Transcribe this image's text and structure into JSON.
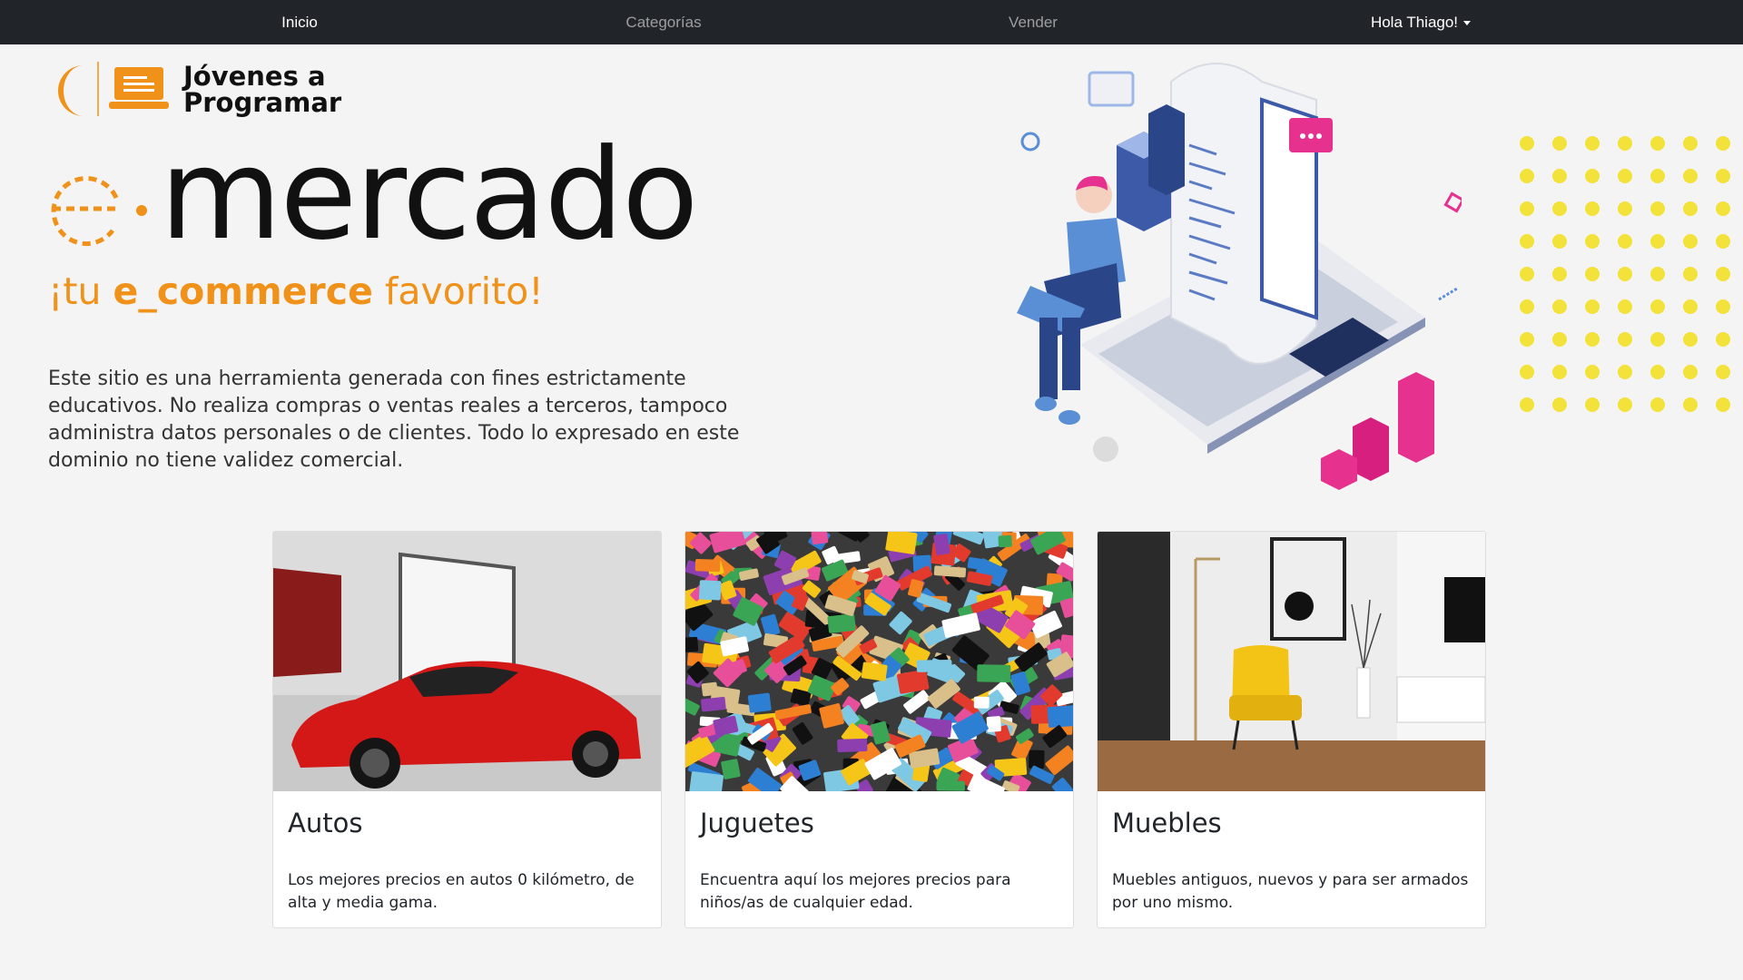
{
  "nav": {
    "home": "Inicio",
    "categories": "Categorías",
    "sell": "Vender",
    "user": "Hola Thiago!"
  },
  "logo": {
    "line1": "Jóvenes a",
    "line2": "Programar"
  },
  "brand": {
    "word": "mercado",
    "tagline_prefix": "¡tu ",
    "tagline_bold": "e_commerce",
    "tagline_suffix": " favorito!"
  },
  "disclaimer": "Este sitio es una herramienta generada con fines estrictamente educativos. No realiza compras o ventas reales a terceros, tampoco administra datos personales o de clientes. Todo lo expresado en este dominio no tiene validez comercial.",
  "colors": {
    "accent": "#f0921a",
    "navbar": "#212529",
    "dots": "#f2e23a",
    "pink": "#e6318f",
    "blue": "#3d5aa8"
  },
  "categories": [
    {
      "title": "Autos",
      "description": "Los mejores precios en autos 0 kilómetro, de alta y media gama.",
      "icon": "red-sports-car-photo"
    },
    {
      "title": "Juguetes",
      "description": "Encuentra aquí los mejores precios para niños/as de cualquier edad.",
      "icon": "lego-bricks-photo"
    },
    {
      "title": "Muebles",
      "description": "Muebles antiguos, nuevos y para ser armados por uno mismo.",
      "icon": "yellow-armchair-photo"
    }
  ]
}
